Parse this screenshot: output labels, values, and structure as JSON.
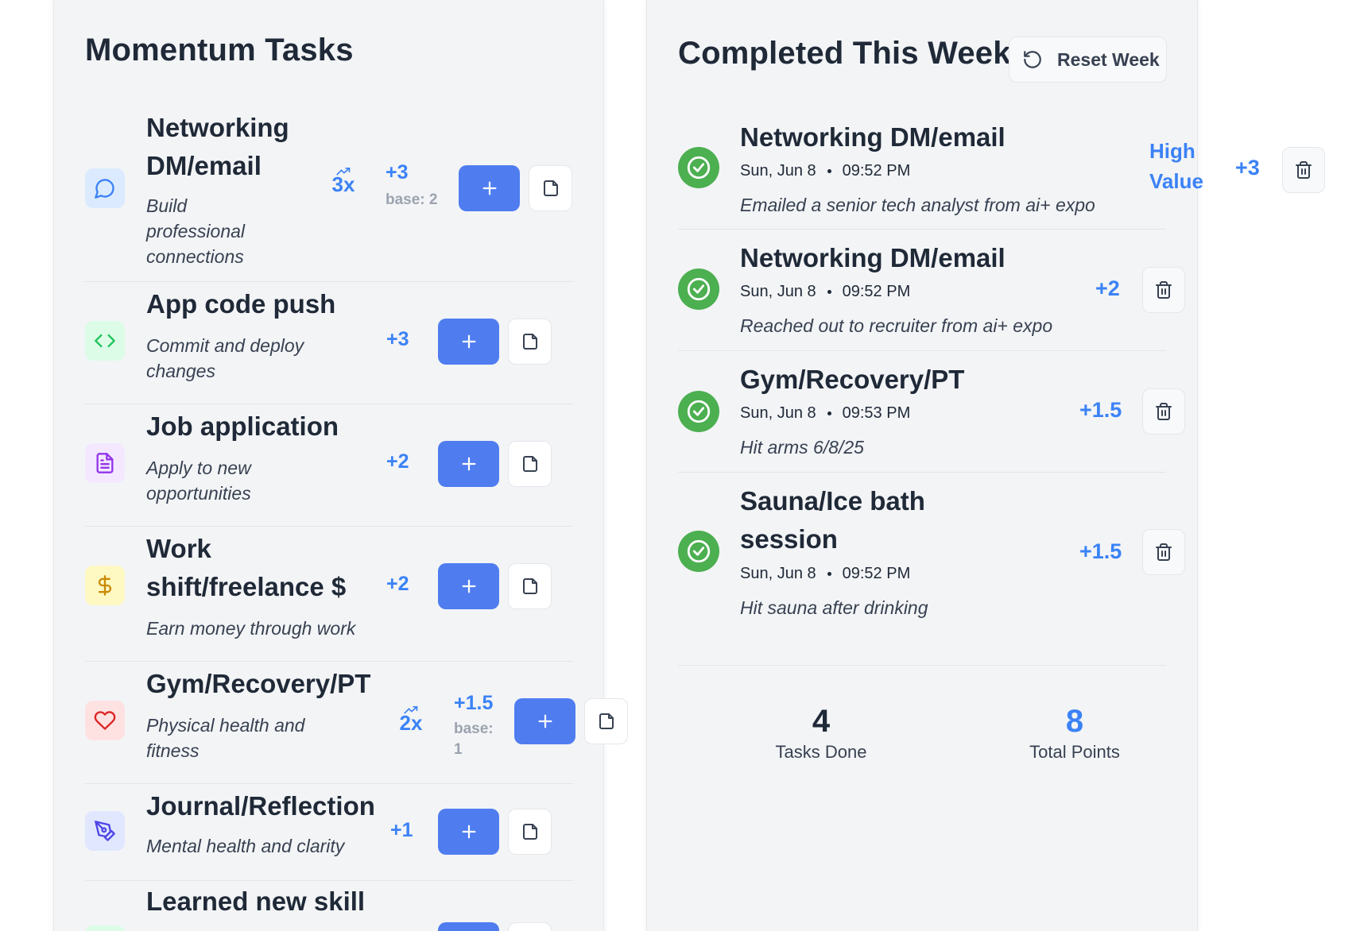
{
  "tasks_panel": {
    "title": "Momentum Tasks",
    "tasks": [
      {
        "title_lines": [
          "Networking",
          "DM/email"
        ],
        "desc_lines": [
          "Build",
          "professional",
          "connections"
        ],
        "multiplier": "3x",
        "points": "+3",
        "base": "base: 2",
        "icon": "message-bubble-icon",
        "icon_color": "#3b82f6",
        "icon_bg": "#dbeafe"
      },
      {
        "title_lines": [
          "App code push"
        ],
        "desc_lines": [
          "Commit and deploy",
          "changes"
        ],
        "points": "+3",
        "icon": "code-brackets-icon",
        "icon_color": "#22c55e",
        "icon_bg": "#dcfce7"
      },
      {
        "title_lines": [
          "Job application"
        ],
        "desc_lines": [
          "Apply to new",
          "opportunities"
        ],
        "points": "+2",
        "icon": "document-text-icon",
        "icon_color": "#9333ea",
        "icon_bg": "#f3e8ff"
      },
      {
        "title_lines": [
          "Work",
          "shift/freelance $"
        ],
        "desc_lines": [
          "Earn money through work"
        ],
        "points": "+2",
        "icon": "dollar-icon",
        "icon_color": "#ca8a04",
        "icon_bg": "#fef9c3"
      },
      {
        "title_lines": [
          "Gym/Recovery/PT"
        ],
        "desc_lines": [
          "Physical health and",
          "fitness"
        ],
        "multiplier": "2x",
        "points": "+1.5",
        "base_lines": [
          "base:",
          "1"
        ],
        "icon": "heart-icon",
        "icon_color": "#dc2626",
        "icon_bg": "#fee2e2"
      },
      {
        "title_lines": [
          "Journal/Reflection"
        ],
        "desc_lines": [
          "Mental health and clarity"
        ],
        "points": "+1",
        "icon": "pen-tool-icon",
        "icon_color": "#4f46e5",
        "icon_bg": "#e0e7ff"
      },
      {
        "title_lines": [
          "Learned new skill"
        ],
        "icon": "skill-icon",
        "icon_color": "#22c55e",
        "icon_bg": "#dcfce7"
      }
    ]
  },
  "completed_panel": {
    "title": "Completed This Week",
    "reset_label": "Reset Week",
    "entries": [
      {
        "title_lines": [
          "Networking DM/email"
        ],
        "date": "Sun, Jun 8",
        "time": "09:52 PM",
        "note": "Emailed a senior tech analyst from ai+ expo",
        "badge_lines": [
          "High",
          "Value"
        ],
        "points": "+3"
      },
      {
        "title_lines": [
          "Networking DM/email"
        ],
        "date": "Sun, Jun 8",
        "time": "09:52 PM",
        "note": "Reached out to recruiter from ai+ expo",
        "points": "+2"
      },
      {
        "title_lines": [
          "Gym/Recovery/PT"
        ],
        "date": "Sun, Jun 8",
        "time": "09:53 PM",
        "note": "Hit arms 6/8/25",
        "points": "+1.5"
      },
      {
        "title_lines": [
          "Sauna/Ice bath",
          "session"
        ],
        "date": "Sun, Jun 8",
        "time": "09:52 PM",
        "note": "Hit sauna after drinking",
        "points": "+1.5"
      }
    ],
    "stats": {
      "tasks_done": {
        "value": "4",
        "label": "Tasks Done",
        "color": "#1f2937"
      },
      "total_points": {
        "value": "8",
        "label": "Total Points",
        "color": "#3b82f6"
      }
    }
  },
  "colors": {
    "accent": "#4f7df0",
    "success": "#4caf50",
    "points": "#3b82f6"
  }
}
